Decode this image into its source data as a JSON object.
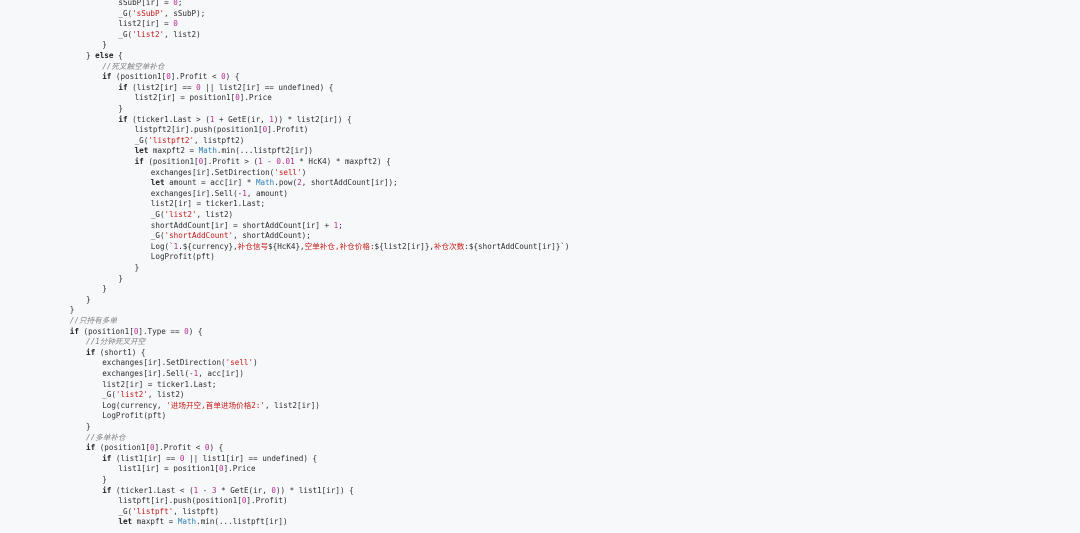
{
  "code": {
    "lines": [
      {
        "indent": 7,
        "tokens": [
          [
            "pl",
            "sSubP[ir] = "
          ],
          [
            "num",
            "0"
          ],
          [
            "pl",
            ";"
          ]
        ]
      },
      {
        "indent": 7,
        "tokens": [
          [
            "pl",
            "_G("
          ],
          [
            "str",
            "'sSubP'"
          ],
          [
            "pl",
            ", sSubP);"
          ]
        ]
      },
      {
        "indent": 7,
        "tokens": [
          [
            "pl",
            "list2[ir] = "
          ],
          [
            "num",
            "0"
          ]
        ]
      },
      {
        "indent": 7,
        "tokens": [
          [
            "pl",
            "_G("
          ],
          [
            "str",
            "'list2'"
          ],
          [
            "pl",
            ", list2)"
          ]
        ]
      },
      {
        "indent": 6,
        "tokens": [
          [
            "pl",
            "}"
          ]
        ]
      },
      {
        "indent": 5,
        "tokens": [
          [
            "pl",
            "} "
          ],
          [
            "kw",
            "else"
          ],
          [
            "pl",
            " {"
          ]
        ]
      },
      {
        "indent": 6,
        "tokens": [
          [
            "cm",
            "//死叉触空单补仓"
          ]
        ]
      },
      {
        "indent": 6,
        "tokens": [
          [
            "kw",
            "if"
          ],
          [
            "pl",
            " (position1["
          ],
          [
            "num",
            "0"
          ],
          [
            "pl",
            "].Profit < "
          ],
          [
            "num",
            "0"
          ],
          [
            "pl",
            ") {"
          ]
        ]
      },
      {
        "indent": 7,
        "tokens": [
          [
            "kw",
            "if"
          ],
          [
            "pl",
            " (list2[ir] == "
          ],
          [
            "num",
            "0"
          ],
          [
            "pl",
            " || list2[ir] == undefined) {"
          ]
        ]
      },
      {
        "indent": 8,
        "tokens": [
          [
            "pl",
            "list2[ir] = position1["
          ],
          [
            "num",
            "0"
          ],
          [
            "pl",
            "].Price"
          ]
        ]
      },
      {
        "indent": 7,
        "tokens": [
          [
            "pl",
            "}"
          ]
        ]
      },
      {
        "indent": 7,
        "tokens": [
          [
            "kw",
            "if"
          ],
          [
            "pl",
            " (ticker1.Last > ("
          ],
          [
            "num",
            "1"
          ],
          [
            "pl",
            " + GetE(ir, "
          ],
          [
            "num",
            "1"
          ],
          [
            "pl",
            ")) * list2[ir]) {"
          ]
        ]
      },
      {
        "indent": 8,
        "tokens": [
          [
            "pl",
            "listpft2[ir].push(position1["
          ],
          [
            "num",
            "0"
          ],
          [
            "pl",
            "].Profit)"
          ]
        ]
      },
      {
        "indent": 8,
        "tokens": [
          [
            "pl",
            "_G("
          ],
          [
            "str",
            "'listpft2'"
          ],
          [
            "pl",
            ", listpft2)"
          ]
        ]
      },
      {
        "indent": 8,
        "tokens": [
          [
            "kw",
            "let"
          ],
          [
            "pl",
            " maxpft2 = "
          ],
          [
            "bi",
            "Math"
          ],
          [
            "pl",
            ".min(...listpft2[ir])"
          ]
        ]
      },
      {
        "indent": 8,
        "tokens": [
          [
            "kw",
            "if"
          ],
          [
            "pl",
            " (position1["
          ],
          [
            "num",
            "0"
          ],
          [
            "pl",
            "].Profit > ("
          ],
          [
            "num",
            "1"
          ],
          [
            "pl",
            " - "
          ],
          [
            "num",
            "0.01"
          ],
          [
            "pl",
            " * HcK4) * maxpft2) {"
          ]
        ]
      },
      {
        "indent": 9,
        "tokens": [
          [
            "pl",
            "exchanges[ir].SetDirection("
          ],
          [
            "str",
            "'sell'"
          ],
          [
            "pl",
            ")"
          ]
        ]
      },
      {
        "indent": 9,
        "tokens": [
          [
            "kw",
            "let"
          ],
          [
            "pl",
            " amount = acc[ir] * "
          ],
          [
            "bi",
            "Math"
          ],
          [
            "pl",
            ".pow("
          ],
          [
            "num",
            "2"
          ],
          [
            "pl",
            ", shortAddCount[ir]);"
          ]
        ]
      },
      {
        "indent": 9,
        "tokens": [
          [
            "pl",
            "exchanges[ir].Sell(-"
          ],
          [
            "num",
            "1"
          ],
          [
            "pl",
            ", amount)"
          ]
        ]
      },
      {
        "indent": 9,
        "tokens": [
          [
            "pl",
            "list2[ir] = ticker1.Last;"
          ]
        ]
      },
      {
        "indent": 9,
        "tokens": [
          [
            "pl",
            "_G("
          ],
          [
            "str",
            "'list2'"
          ],
          [
            "pl",
            ", list2)"
          ]
        ]
      },
      {
        "indent": 9,
        "tokens": [
          [
            "pl",
            "shortAddCount[ir] = shortAddCount[ir] + "
          ],
          [
            "num",
            "1"
          ],
          [
            "pl",
            ";"
          ]
        ]
      },
      {
        "indent": 9,
        "tokens": [
          [
            "pl",
            "_G("
          ],
          [
            "str",
            "'shortAddCount'"
          ],
          [
            "pl",
            ", shortAddCount);"
          ]
        ]
      },
      {
        "indent": 9,
        "tokens": [
          [
            "pl",
            "Log(`"
          ],
          [
            "num",
            "1"
          ],
          [
            "pl",
            ".${currency},"
          ],
          [
            "str",
            "补仓信号"
          ],
          [
            "pl",
            "${HcK4},"
          ],
          [
            "str",
            "空单补仓,补仓价格"
          ],
          [
            "pl",
            ":${list2[ir]},"
          ],
          [
            "str",
            "补仓次数"
          ],
          [
            "pl",
            ":${shortAddCount[ir]}`)"
          ]
        ]
      },
      {
        "indent": 9,
        "tokens": [
          [
            "pl",
            "LogProfit(pft)"
          ]
        ]
      },
      {
        "indent": 8,
        "tokens": [
          [
            "pl",
            "}"
          ]
        ]
      },
      {
        "indent": 7,
        "tokens": [
          [
            "pl",
            "}"
          ]
        ]
      },
      {
        "indent": 6,
        "tokens": [
          [
            "pl",
            "}"
          ]
        ]
      },
      {
        "indent": 5,
        "tokens": [
          [
            "pl",
            "}"
          ]
        ]
      },
      {
        "indent": 4,
        "tokens": [
          [
            "pl",
            "}"
          ]
        ]
      },
      {
        "indent": 4,
        "tokens": [
          [
            "cm",
            "//只持有多单"
          ]
        ]
      },
      {
        "indent": 4,
        "tokens": [
          [
            "kw",
            "if"
          ],
          [
            "pl",
            " (position1["
          ],
          [
            "num",
            "0"
          ],
          [
            "pl",
            "].Type == "
          ],
          [
            "num",
            "0"
          ],
          [
            "pl",
            ") {"
          ]
        ]
      },
      {
        "indent": 5,
        "tokens": [
          [
            "cm",
            "//1分钟死叉开空"
          ]
        ]
      },
      {
        "indent": 5,
        "tokens": [
          [
            "kw",
            "if"
          ],
          [
            "pl",
            " (short1) {"
          ]
        ]
      },
      {
        "indent": 6,
        "tokens": [
          [
            "pl",
            "exchanges[ir].SetDirection("
          ],
          [
            "str",
            "'sell'"
          ],
          [
            "pl",
            ")"
          ]
        ]
      },
      {
        "indent": 6,
        "tokens": [
          [
            "pl",
            "exchanges[ir].Sell(-"
          ],
          [
            "num",
            "1"
          ],
          [
            "pl",
            ", acc[ir])"
          ]
        ]
      },
      {
        "indent": 6,
        "tokens": [
          [
            "pl",
            "list2[ir] = ticker1.Last;"
          ]
        ]
      },
      {
        "indent": 6,
        "tokens": [
          [
            "pl",
            "_G("
          ],
          [
            "str",
            "'list2'"
          ],
          [
            "pl",
            ", list2)"
          ]
        ]
      },
      {
        "indent": 6,
        "tokens": [
          [
            "pl",
            "Log(currency, "
          ],
          [
            "str",
            "'进场开空,首单进场价格2:'"
          ],
          [
            "pl",
            ", list2[ir])"
          ]
        ]
      },
      {
        "indent": 6,
        "tokens": [
          [
            "pl",
            "LogProfit(pft)"
          ]
        ]
      },
      {
        "indent": 5,
        "tokens": [
          [
            "pl",
            "}"
          ]
        ]
      },
      {
        "indent": 5,
        "tokens": [
          [
            "cm",
            "//多单补仓"
          ]
        ]
      },
      {
        "indent": 5,
        "tokens": [
          [
            "kw",
            "if"
          ],
          [
            "pl",
            " (position1["
          ],
          [
            "num",
            "0"
          ],
          [
            "pl",
            "].Profit < "
          ],
          [
            "num",
            "0"
          ],
          [
            "pl",
            ") {"
          ]
        ]
      },
      {
        "indent": 6,
        "tokens": [
          [
            "kw",
            "if"
          ],
          [
            "pl",
            " (list1[ir] == "
          ],
          [
            "num",
            "0"
          ],
          [
            "pl",
            " || list1[ir] == undefined) {"
          ]
        ]
      },
      {
        "indent": 7,
        "tokens": [
          [
            "pl",
            "list1[ir] = position1["
          ],
          [
            "num",
            "0"
          ],
          [
            "pl",
            "].Price"
          ]
        ]
      },
      {
        "indent": 6,
        "tokens": [
          [
            "pl",
            "}"
          ]
        ]
      },
      {
        "indent": 6,
        "tokens": [
          [
            "kw",
            "if"
          ],
          [
            "pl",
            " (ticker1.Last < ("
          ],
          [
            "num",
            "1"
          ],
          [
            "pl",
            " - "
          ],
          [
            "num",
            "3"
          ],
          [
            "pl",
            " * GetE(ir, "
          ],
          [
            "num",
            "0"
          ],
          [
            "pl",
            ")) * list1[ir]) {"
          ]
        ]
      },
      {
        "indent": 7,
        "tokens": [
          [
            "pl",
            "listpft[ir].push(position1["
          ],
          [
            "num",
            "0"
          ],
          [
            "pl",
            "].Profit)"
          ]
        ]
      },
      {
        "indent": 7,
        "tokens": [
          [
            "pl",
            "_G("
          ],
          [
            "str",
            "'listpft'"
          ],
          [
            "pl",
            ", listpft)"
          ]
        ]
      },
      {
        "indent": 7,
        "tokens": [
          [
            "kw",
            "let"
          ],
          [
            "pl",
            " maxpft = "
          ],
          [
            "bi",
            "Math"
          ],
          [
            "pl",
            ".min(...listpft[ir])"
          ]
        ]
      }
    ]
  },
  "colors": {
    "background": "#f7f8fa",
    "text": "#2e2e2e",
    "keyword": "#222222",
    "string": "#c41a16",
    "number": "#b5298f",
    "comment": "#7f7f7f",
    "builtin": "#2e7fb3"
  }
}
